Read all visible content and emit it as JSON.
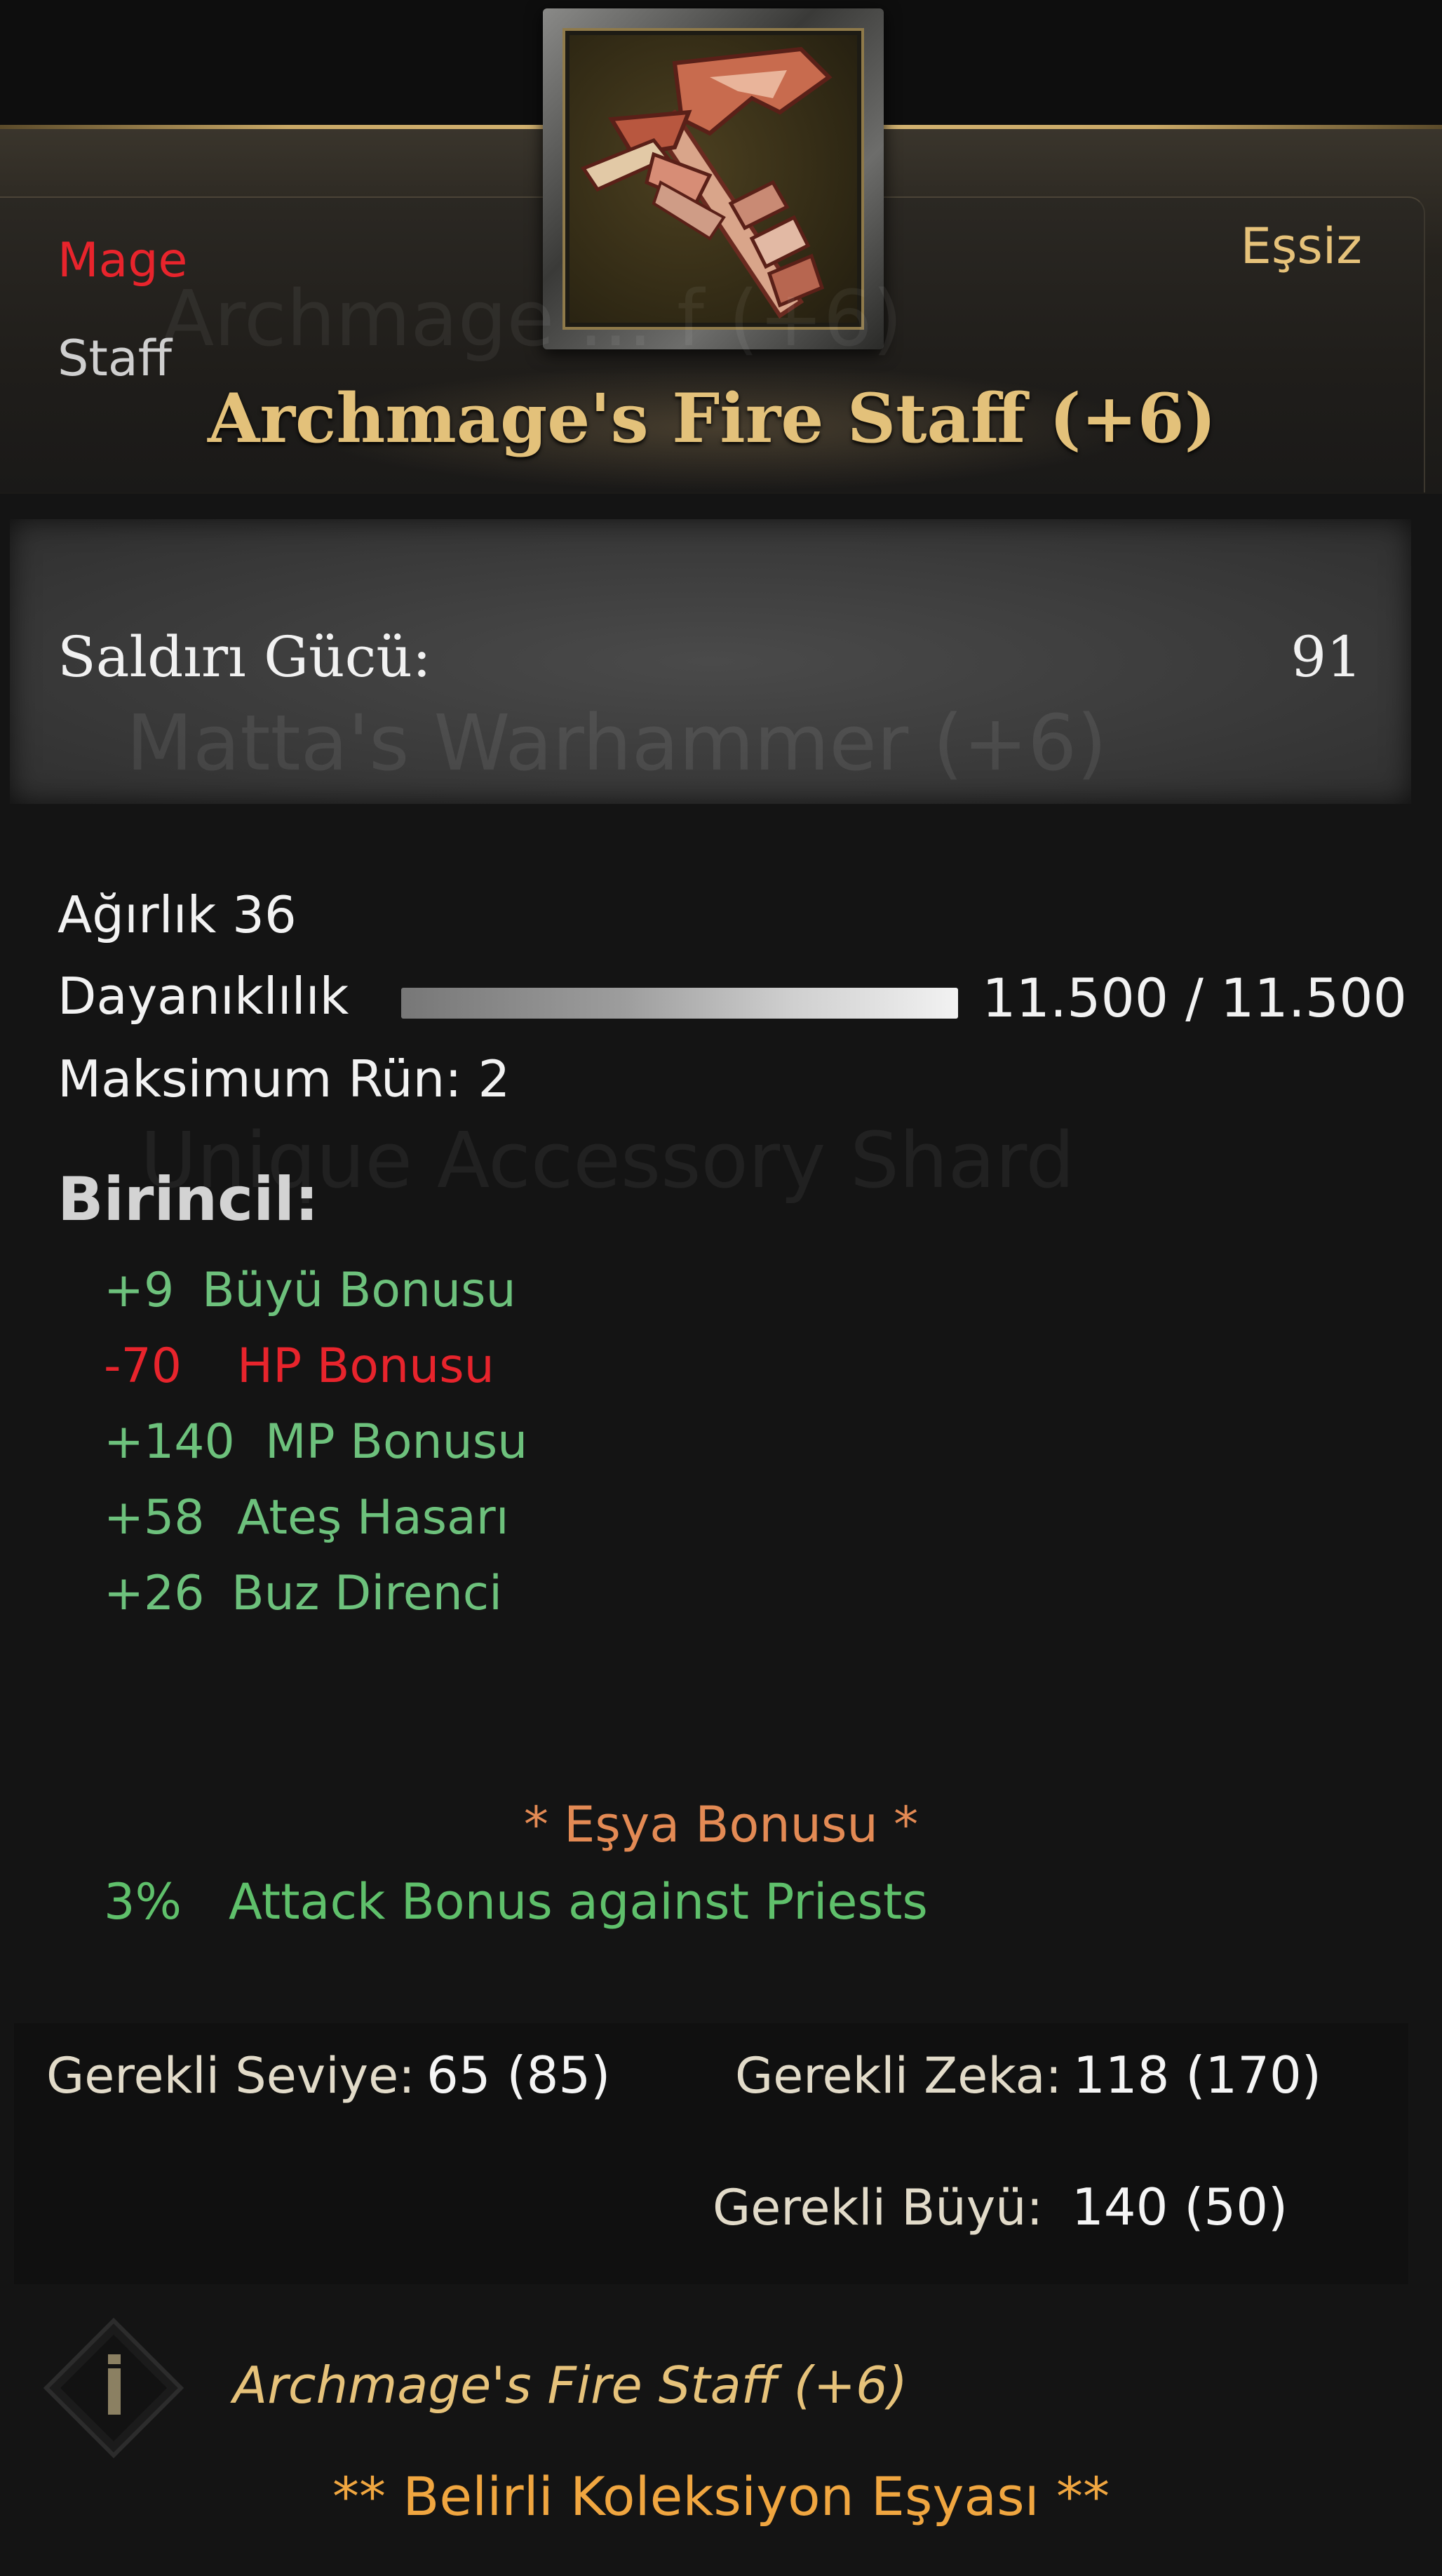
{
  "header": {
    "class": "Mage",
    "type": "Staff",
    "rarity": "Eşsiz",
    "title": "Archmage's Fire Staff (+6)",
    "ghost_title": "Archmage ... f (+6)"
  },
  "attack": {
    "label": "Saldırı Gücü:",
    "value": "91",
    "ghost_text": "Matta's Warhammer (+6)"
  },
  "stats": {
    "weight": "Ağırlık 36",
    "durability_label": "Dayanıklılık",
    "durability_value": "11.500 / 11.500",
    "durability_fraction": 1.0,
    "max_rune": "Maksimum Rün: 2",
    "ghost_text": "Unique Accessory Shard"
  },
  "primary": {
    "heading": "Birincil:",
    "bonuses": [
      {
        "value": "+9",
        "name": "Büyü Bonusu",
        "color": "#6dc17c"
      },
      {
        "value": "-70",
        "name": "HP Bonusu",
        "color": "#e8242c"
      },
      {
        "value": "+140",
        "name": "MP Bonusu",
        "color": "#6dc17c"
      },
      {
        "value": "+58",
        "name": "Ateş Hasarı",
        "color": "#6dc17c"
      },
      {
        "value": "+26",
        "name": "Buz Direnci",
        "color": "#6dc17c"
      }
    ]
  },
  "set_bonus": {
    "heading": "* Eşya Bonusu *",
    "value": "3%",
    "text": "Attack Bonus against Priests"
  },
  "requirements": {
    "level_label": "Gerekli Seviye:",
    "level_value": "65 (85)",
    "int_label": "Gerekli Zeka:",
    "int_value": "118 (170)",
    "magic_label": "Gerekli Büyü:",
    "magic_value": "140 (50)",
    "unmet_color": "#e8242c"
  },
  "footer": {
    "icon": "info-diamond-icon",
    "name": "Archmage's Fire Staff (+6)",
    "collection": "** Belirli Koleksiyon Eşyası **"
  }
}
